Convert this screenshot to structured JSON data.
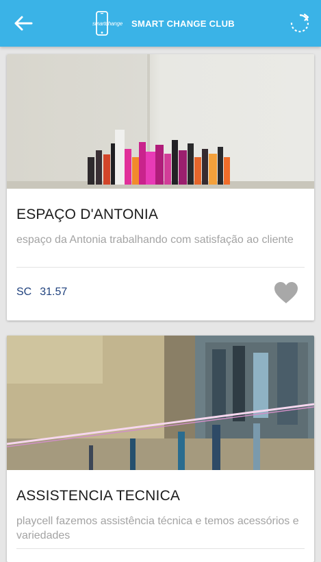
{
  "header": {
    "logo_small": "smartchange",
    "logo_title": "SMART CHANGE CLUB",
    "accent_color": "#3ab3e7",
    "back_icon": "arrow-left-icon",
    "refresh_icon": "refresh-icon"
  },
  "cards": [
    {
      "title": "ESPAÇO D'ANTONIA",
      "description": "espaço da Antonia trabalhando com satisfação ao cliente",
      "currency": "SC",
      "amount": "31.57",
      "favorite_icon": "heart-icon"
    },
    {
      "title": "ASSISTENCIA TECNICA",
      "description": "playcell fazemos assistência técnica e temos acessórios e variedades"
    }
  ]
}
